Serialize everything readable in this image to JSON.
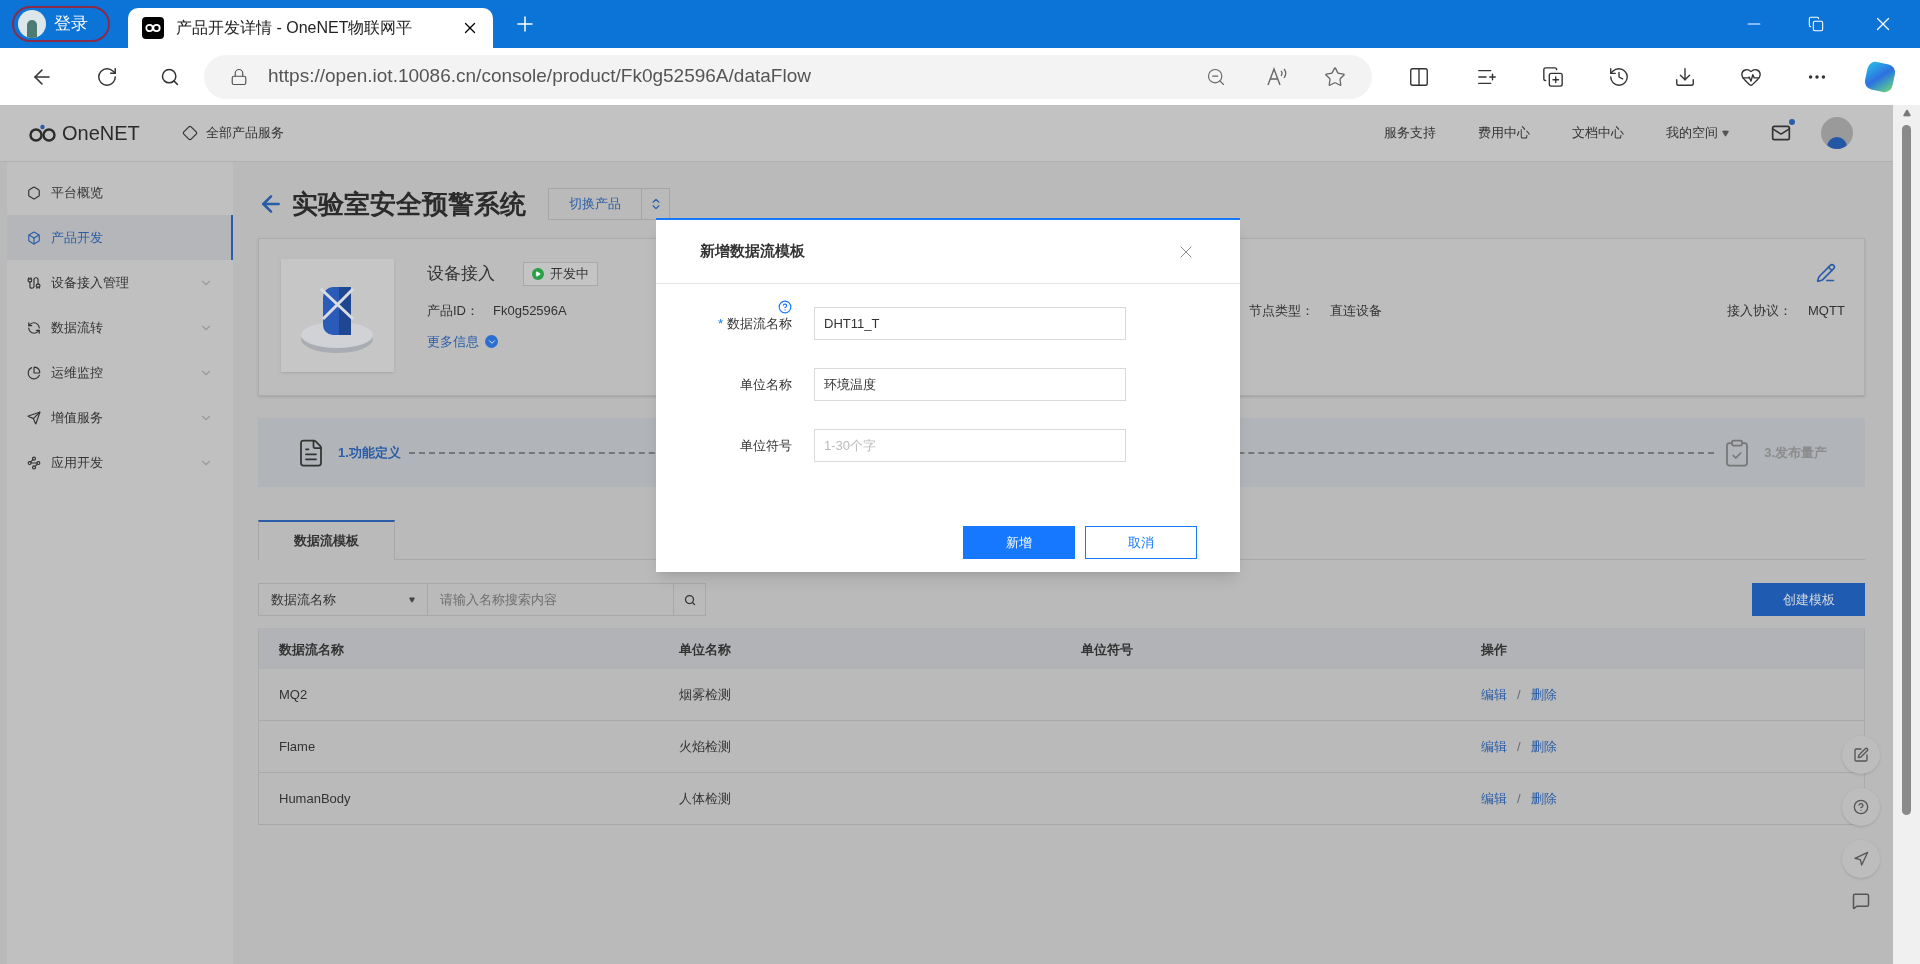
{
  "browser": {
    "profile": "登录",
    "tab_title": "产品开发详情 - OneNET物联网平",
    "url": "https://open.iot.10086.cn/console/product/Fk0g52596A/dataFlow"
  },
  "header": {
    "brand": "OneNET",
    "all_services": "全部产品服务",
    "links": [
      "服务支持",
      "费用中心",
      "文档中心"
    ],
    "my_space": "我的空间",
    "mail_unread": true
  },
  "sidebar": {
    "items": [
      {
        "label": "平台概览",
        "selected": false,
        "expandable": false
      },
      {
        "label": "产品开发",
        "selected": true,
        "expandable": false
      },
      {
        "label": "设备接入管理",
        "selected": false,
        "expandable": true
      },
      {
        "label": "数据流转",
        "selected": false,
        "expandable": true
      },
      {
        "label": "运维监控",
        "selected": false,
        "expandable": true
      },
      {
        "label": "增值服务",
        "selected": false,
        "expandable": true
      },
      {
        "label": "应用开发",
        "selected": false,
        "expandable": true
      }
    ]
  },
  "product": {
    "title": "实验室安全预警系统",
    "switch_button": "切换产品",
    "name": "设备接入",
    "status": "开发中",
    "id_label": "产品ID：",
    "id_value": "Fk0g52596A",
    "more_info": "更多信息",
    "fields": [
      {
        "label": "节点类型：",
        "value": "直连设备"
      },
      {
        "label": "接入协议：",
        "value": "MQTT"
      }
    ]
  },
  "steps": [
    {
      "label": "1.功能定义",
      "active": true
    },
    {
      "label": "3.发布量产",
      "active": false
    }
  ],
  "tabs": [
    {
      "label": "数据流模板",
      "selected": true
    }
  ],
  "filter": {
    "select": "数据流名称",
    "placeholder": "请输入名称搜索内容"
  },
  "create_button": "创建模板",
  "table": {
    "columns": [
      "数据流名称",
      "单位名称",
      "单位符号",
      "操作"
    ],
    "rows": [
      {
        "name": "MQ2",
        "unit_name": "烟雾检测",
        "actions": [
          "编辑",
          "删除"
        ],
        "separator": "/"
      },
      {
        "name": "Flame",
        "unit_name": "火焰检测",
        "actions": [
          "编辑",
          "删除"
        ],
        "separator": "/"
      },
      {
        "name": "HumanBody",
        "unit_name": "人体检测",
        "actions": [
          "编辑",
          "删除"
        ],
        "separator": "/"
      }
    ]
  },
  "dialog": {
    "title": "新增数据流模板",
    "fields": [
      {
        "label": "数据流名称",
        "required_mark": "*",
        "help": true,
        "value": "DHT11_T"
      },
      {
        "label": "单位名称",
        "help": false,
        "value": "环境温度"
      },
      {
        "label": "单位符号",
        "help": false,
        "placeholder": "1-30个字"
      }
    ],
    "buttons": [
      {
        "label": "新增",
        "kind": "primary"
      },
      {
        "label": "取消",
        "kind": "secondary"
      }
    ]
  }
}
